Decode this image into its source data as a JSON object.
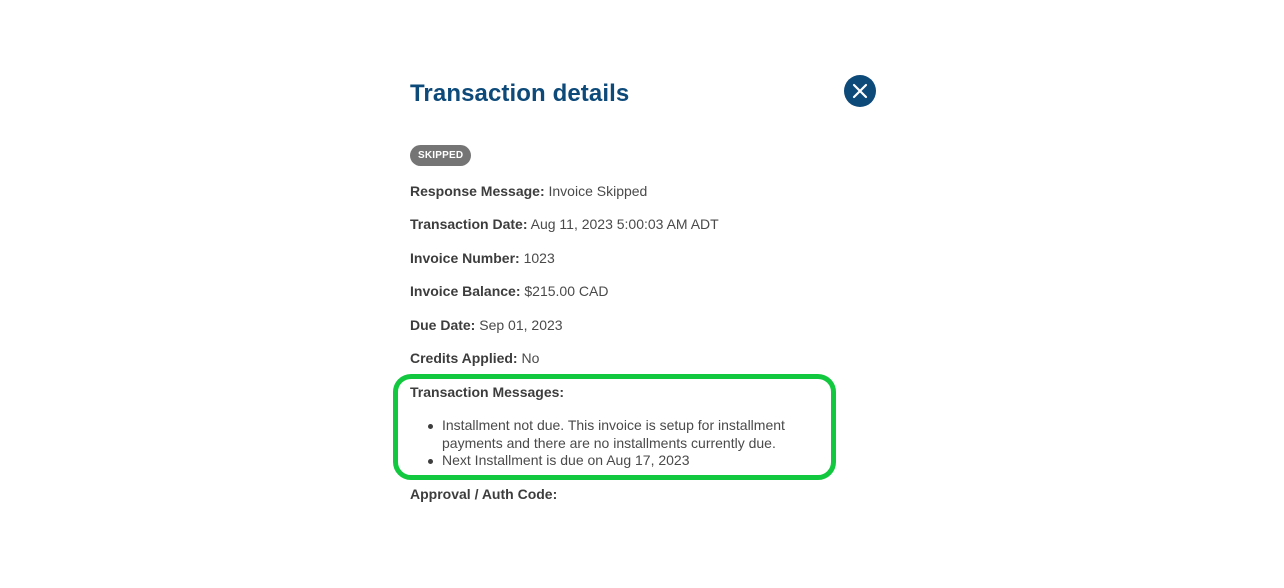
{
  "dialog": {
    "title": "Transaction details",
    "close_icon": "close-icon",
    "status_badge": "SKIPPED",
    "fields": {
      "response_message": {
        "label": "Response Message:",
        "value": "Invoice Skipped"
      },
      "transaction_date": {
        "label": "Transaction Date:",
        "value": "Aug 11, 2023 5:00:03 AM ADT"
      },
      "invoice_number": {
        "label": "Invoice Number:",
        "value": "1023"
      },
      "invoice_balance": {
        "label": "Invoice Balance:",
        "value": "$215.00 CAD"
      },
      "due_date": {
        "label": "Due Date:",
        "value": "Sep 01, 2023"
      },
      "credits_applied": {
        "label": "Credits Applied:",
        "value": "No"
      },
      "transaction_messages": {
        "label": "Transaction Messages:",
        "items": [
          "Installment not due. This invoice is setup for installment payments and there are no installments currently due.",
          "Next Installment is due on Aug 17, 2023"
        ]
      },
      "approval_code": {
        "label": "Approval / Auth Code:",
        "value": ""
      }
    }
  },
  "colors": {
    "title": "#0d4a7a",
    "close_button": "#0d4a7a",
    "badge": "#757575",
    "highlight_box": "#12c83f"
  }
}
